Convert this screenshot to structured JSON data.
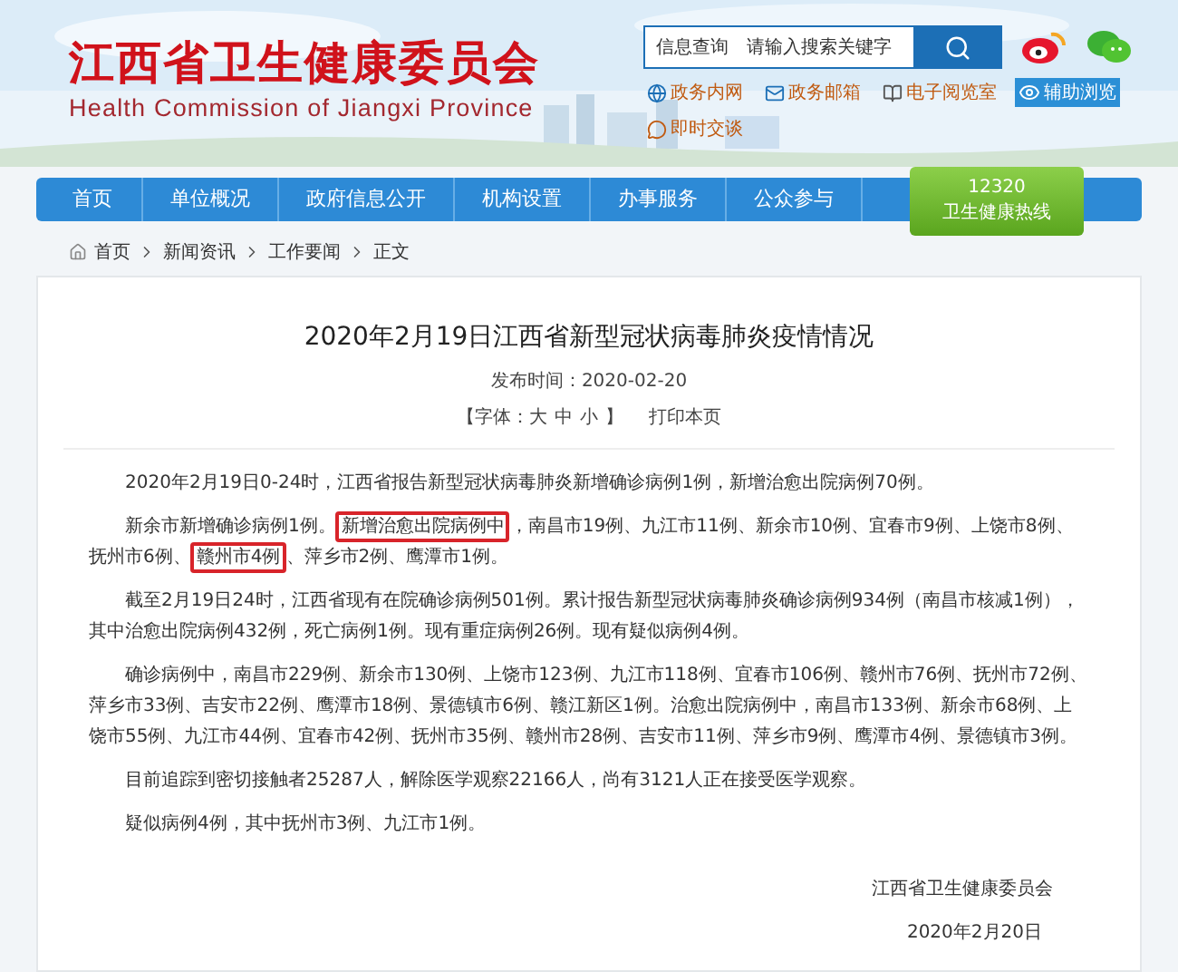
{
  "header": {
    "title": "江西省卫生健康委员会",
    "subtitle": "Health Commission of Jiangxi Province",
    "search": {
      "label": "信息查询",
      "placeholder": "请输入搜索关键字"
    },
    "links": [
      {
        "label": "政务内网",
        "kind": "network"
      },
      {
        "label": "政务邮箱",
        "kind": "mail"
      },
      {
        "label": "电子阅览室",
        "kind": "reader"
      },
      {
        "label": "辅助浏览",
        "kind": "accessibility"
      },
      {
        "label": "即时交谈",
        "kind": "chat"
      }
    ]
  },
  "nav": {
    "items": [
      "首页",
      "单位概况",
      "政府信息公开",
      "机构设置",
      "办事服务",
      "公众参与"
    ],
    "hotline": {
      "number": "12320",
      "label": "卫生健康热线"
    }
  },
  "breadcrumb": [
    "首页",
    "新闻资讯",
    "工作要闻",
    "正文"
  ],
  "article": {
    "title": "2020年2月19日江西省新型冠状病毒肺炎疫情情况",
    "published": "发布时间：2020-02-20",
    "font_label": "【字体：",
    "font_sizes": [
      "大",
      "中",
      "小"
    ],
    "font_end": "】",
    "print": "打印本页",
    "paragraphs": [
      [
        {
          "text": "2020年2月19日0-24时，江西省报告新型冠状病毒肺炎新增确诊病例1例，新增治愈出院病例70例。",
          "highlighted": false
        }
      ],
      [
        {
          "text": "新余市新增确诊病例1例。",
          "highlighted": false
        },
        {
          "text": "新增治愈出院病例中",
          "highlighted": true
        },
        {
          "text": "，南昌市19例、九江市11例、新余市10例、宜春市9例、上饶市8例、抚州市6例、",
          "highlighted": false
        },
        {
          "text": "赣州市4例",
          "highlighted": true
        },
        {
          "text": "、萍乡市2例、鹰潭市1例。",
          "highlighted": false
        }
      ],
      [
        {
          "text": "截至2月19日24时，江西省现有在院确诊病例501例。累计报告新型冠状病毒肺炎确诊病例934例（南昌市核减1例），其中治愈出院病例432例，死亡病例1例。现有重症病例26例。现有疑似病例4例。",
          "highlighted": false
        }
      ],
      [
        {
          "text": "确诊病例中，南昌市229例、新余市130例、上饶市123例、九江市118例、宜春市106例、赣州市76例、抚州市72例、萍乡市33例、吉安市22例、鹰潭市18例、景德镇市6例、赣江新区1例。治愈出院病例中，南昌市133例、新余市68例、上饶市55例、九江市44例、宜春市42例、抚州市35例、赣州市28例、吉安市11例、萍乡市9例、鹰潭市4例、景德镇市3例。",
          "highlighted": false
        }
      ],
      [
        {
          "text": "目前追踪到密切接触者25287人，解除医学观察22166人，尚有3121人正在接受医学观察。",
          "highlighted": false
        }
      ],
      [
        {
          "text": "疑似病例4例，其中抚州市3例、九江市1例。",
          "highlighted": false
        }
      ]
    ],
    "signature": "江西省卫生健康委员会",
    "date": "2020年2月20日"
  }
}
